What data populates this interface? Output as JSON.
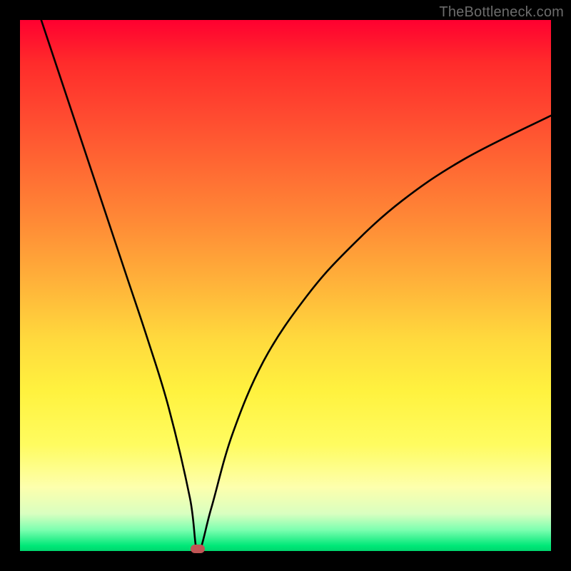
{
  "watermark": "TheBottleneck.com",
  "colors": {
    "frame": "#000000",
    "marker": "#c05555",
    "curve": "#000000"
  },
  "chart_data": {
    "type": "line",
    "title": "",
    "xlabel": "",
    "ylabel": "",
    "xlim": [
      0,
      100
    ],
    "ylim": [
      0,
      100
    ],
    "background_gradient": {
      "top": "#ff0030",
      "bottom": "#00d66e",
      "meaning": "top=high bottleneck (red), bottom=low bottleneck (green)"
    },
    "series": [
      {
        "name": "bottleneck-curve",
        "x": [
          4,
          8,
          12,
          16,
          20,
          24,
          28,
          32,
          33.5,
          36,
          40,
          46,
          54,
          62,
          72,
          84,
          100
        ],
        "values": [
          100,
          88,
          76,
          64,
          52,
          40,
          27,
          10,
          0,
          8,
          22,
          36,
          48,
          57,
          66,
          74,
          82
        ]
      }
    ],
    "marker": {
      "x": 33.5,
      "y": 0
    },
    "grid": false,
    "legend": false
  }
}
